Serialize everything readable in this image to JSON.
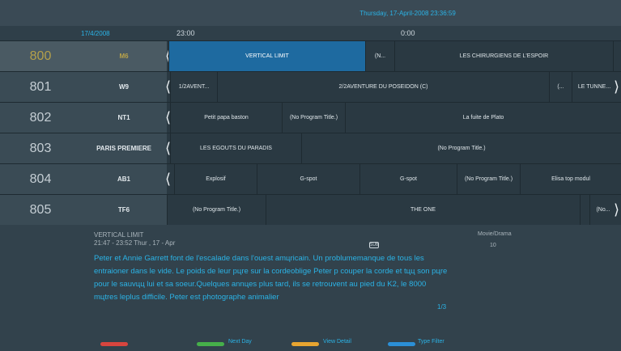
{
  "header": {
    "datetime": "Thursday, 17-April-2008 23:36:59",
    "date": "17/4/2008",
    "time_slots": [
      "23:00",
      "0:00"
    ]
  },
  "channels": [
    {
      "number": "800",
      "name": "M6",
      "programs": [
        "VERTICAL LIMIT",
        "(N...",
        "LES CHIRURGIENS DE L'ESPOIR"
      ]
    },
    {
      "number": "801",
      "name": "W9",
      "programs": [
        "1/2AVENT...",
        "2/2AVENTURE DU POSEIDON (C)",
        "(...",
        "LE TUNNE..."
      ]
    },
    {
      "number": "802",
      "name": "NT1",
      "programs": [
        "Petit papa baston",
        "(No Program Title.)",
        "La fuite de Plato"
      ]
    },
    {
      "number": "803",
      "name": "PARIS PREMIERE",
      "programs": [
        "LES EGOUTS DU PARADIS",
        "(No Program Title.)"
      ]
    },
    {
      "number": "804",
      "name": "AB1",
      "programs": [
        "Explosif",
        "G-spot",
        "G-spot",
        "(No Program Title.)",
        "Elisa top modul"
      ]
    },
    {
      "number": "805",
      "name": "TF6",
      "programs": [
        "(No Program Title.)",
        "THE ONE",
        "(No..."
      ]
    }
  ],
  "info": {
    "title": "VERTICAL LIMIT",
    "time": "21:47 - 23:52  Thur , 17 - Apr",
    "genre": "Movie/Drama",
    "rating": "10",
    "badge": "SUB",
    "description": "Peter et Annie Garrett font de l'escalade dans l'ouest amцricain. Un problumemanque de tous les entraioner dans le vide. Le poids de leur pцre sur la cordeoblige Peter p couper la corde et tцц son pцre pour le sauvцц lui et sa soeur.Quelques annцes plus tard, ils se retrouvent au pied du K2, le 8000 mцtres leplus difficile. Peter est photographe animalier",
    "page": "1/3"
  },
  "legend": {
    "red": "",
    "green": "Next Day",
    "yellow": "View Detail",
    "blue": "Type Filter"
  },
  "colors": {
    "accent": "#2bb3e6",
    "active_program": "#1e6aa0",
    "red": "#d8453e",
    "green": "#46b04a",
    "yellow": "#e8a530",
    "blue": "#2b8fd6"
  }
}
